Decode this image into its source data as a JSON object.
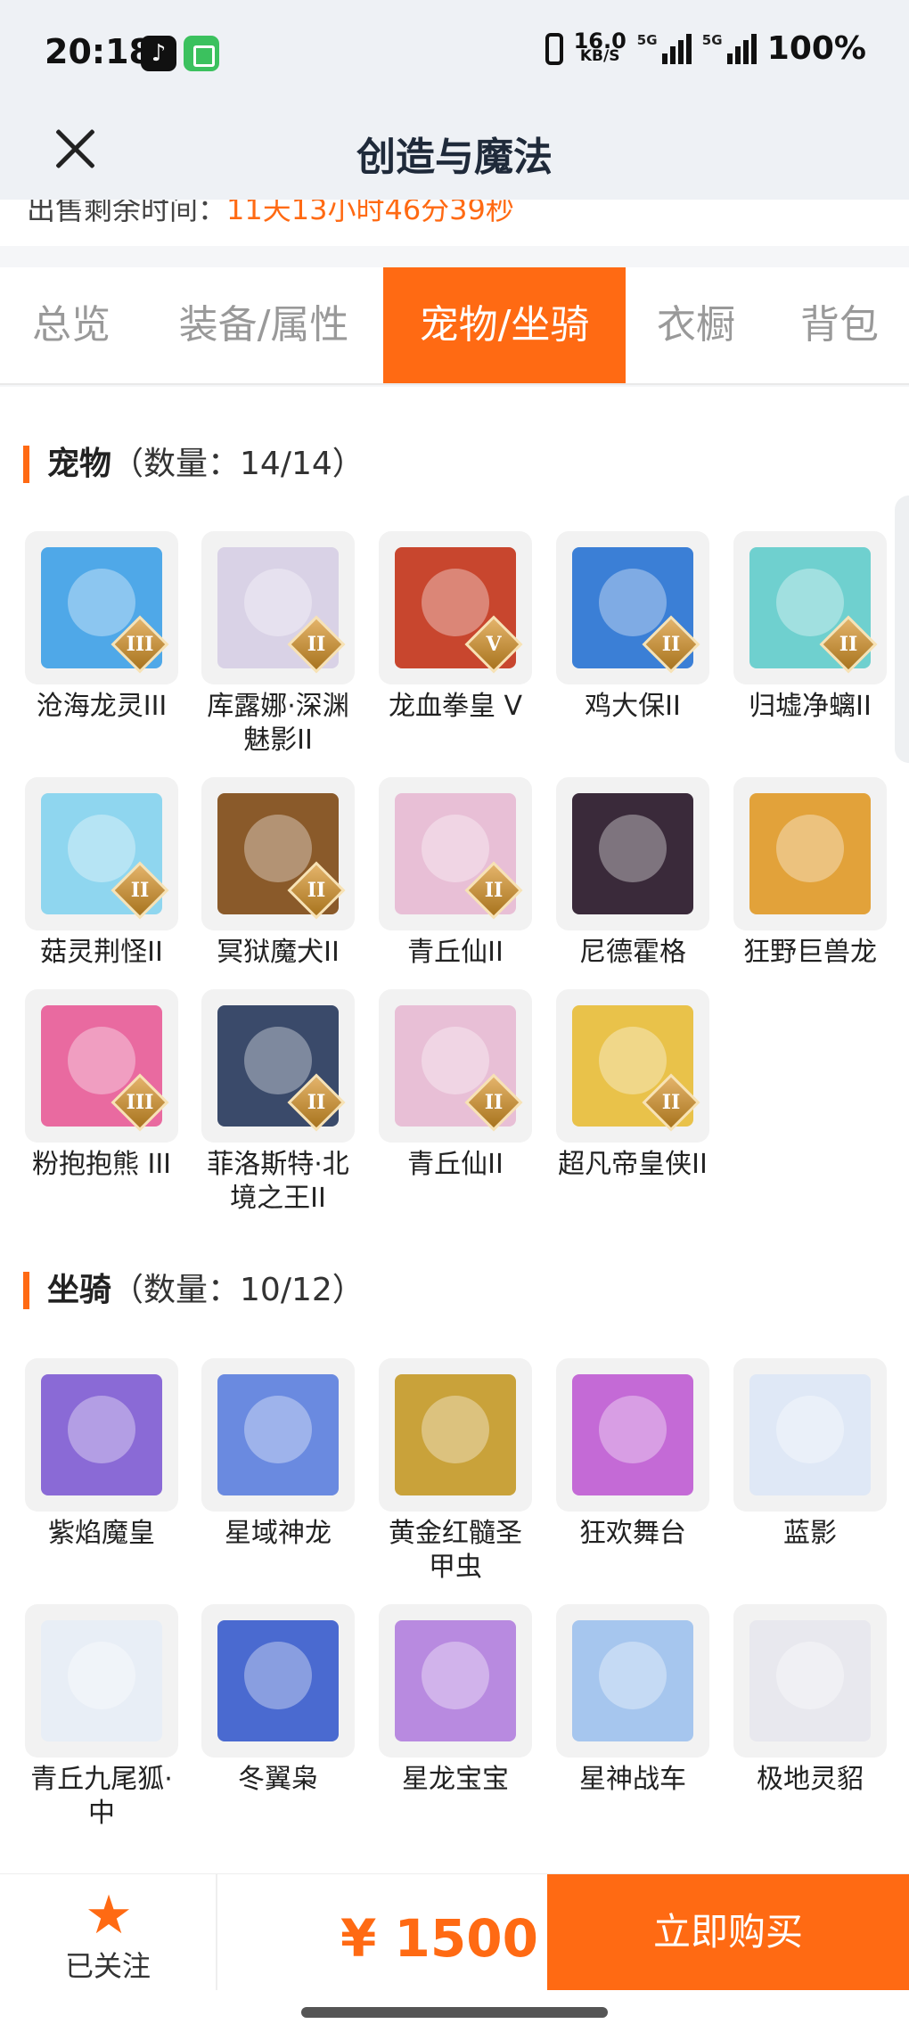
{
  "status_bar": {
    "time": "20:18",
    "net_speed_value": "16.0",
    "net_speed_unit": "KB/S",
    "signal1_tag": "5G",
    "signal2_tag": "5G",
    "battery": "100%"
  },
  "nav": {
    "title": "创造与魔法"
  },
  "sale": {
    "label": "出售剩余时间：",
    "time": "11天13小时46分39秒"
  },
  "tabs": [
    {
      "label": "总览"
    },
    {
      "label": "装备/属性"
    },
    {
      "label": "宠物/坐骑"
    },
    {
      "label": "衣橱"
    },
    {
      "label": "背包"
    }
  ],
  "active_tab": "宠物/坐骑",
  "pets": {
    "title": "宠物",
    "count": "（数量：14/14）",
    "items": [
      {
        "name": "沧海龙灵III",
        "badge": "III",
        "color": "#4fa8e8"
      },
      {
        "name": "库露娜·深渊魅影II",
        "badge": "II",
        "color": "#d9d2e6"
      },
      {
        "name": "龙血拳皇 V",
        "badge": "V",
        "color": "#c8462e"
      },
      {
        "name": "鸡大保II",
        "badge": "II",
        "color": "#3b7fd6"
      },
      {
        "name": "归墟净螭II",
        "badge": "II",
        "color": "#6fd0cf"
      },
      {
        "name": "菇灵荆怪II",
        "badge": "II",
        "color": "#8fd6ef"
      },
      {
        "name": "冥狱魔犬II",
        "badge": "II",
        "color": "#8a5a2a"
      },
      {
        "name": "青丘仙II",
        "badge": "II",
        "color": "#e8bfd6"
      },
      {
        "name": "尼德霍格",
        "badge": "",
        "color": "#3a2a3a"
      },
      {
        "name": "狂野巨兽龙",
        "badge": "",
        "color": "#e2a23a"
      },
      {
        "name": "粉抱抱熊 III",
        "badge": "III",
        "color": "#e96aa0"
      },
      {
        "name": "菲洛斯特·北境之王II",
        "badge": "II",
        "color": "#3a4a6a"
      },
      {
        "name": "青丘仙II",
        "badge": "II",
        "color": "#e8bfd6"
      },
      {
        "name": "超凡帝皇侠II",
        "badge": "II",
        "color": "#e9c24a"
      }
    ]
  },
  "mounts": {
    "title": "坐骑",
    "count": "（数量：10/12）",
    "items": [
      {
        "name": "紫焰魔皇",
        "color": "#8a6ad6"
      },
      {
        "name": "星域神龙",
        "color": "#6a8ae0"
      },
      {
        "name": "黄金红髓圣甲虫",
        "color": "#c9a23a"
      },
      {
        "name": "狂欢舞台",
        "color": "#c46ad6"
      },
      {
        "name": "蓝影",
        "color": "#dfe8f6"
      },
      {
        "name": "青丘九尾狐·中",
        "color": "#e8eef6"
      },
      {
        "name": "冬翼枭",
        "color": "#4a6ad0"
      },
      {
        "name": "星龙宝宝",
        "color": "#b88ae0"
      },
      {
        "name": "星神战车",
        "color": "#a6c6ee"
      },
      {
        "name": "极地灵貂",
        "color": "#e8e8ee"
      }
    ]
  },
  "bottom": {
    "follow_label": "已关注",
    "price": "¥ 1500",
    "buy_label": "立即购买",
    "accent": "#ff6a13"
  }
}
